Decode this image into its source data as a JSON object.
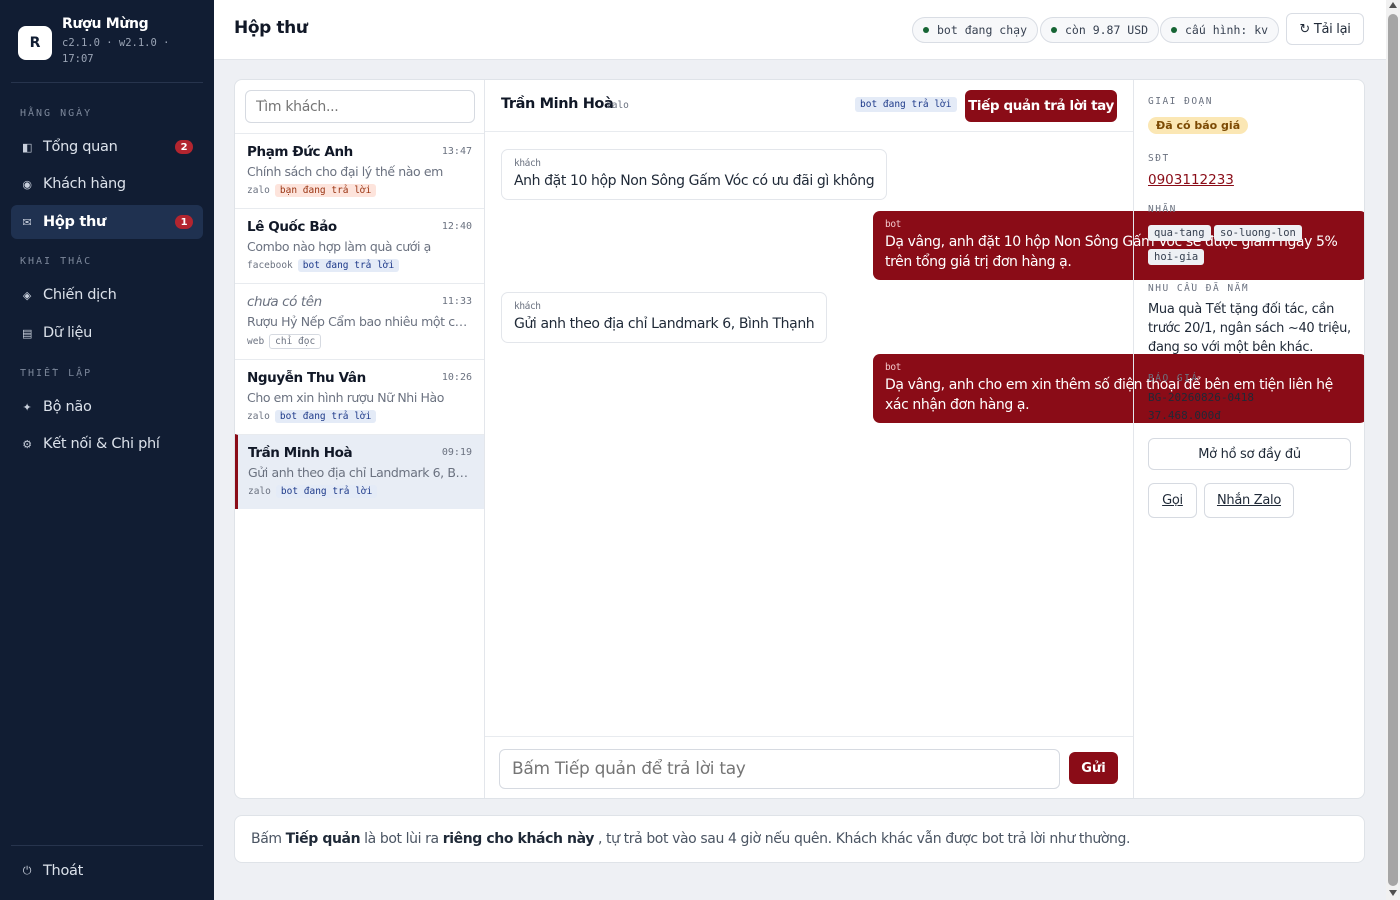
{
  "brand": {
    "initial": "R",
    "name": "Rượu Mừng",
    "version": "c2.1.0 · w2.1.0 · 17:07"
  },
  "sidebar": {
    "sections": [
      {
        "label": "HẰNG NGÀY"
      },
      {
        "label": "KHAI THÁC"
      },
      {
        "label": "THIẾT LẬP"
      }
    ],
    "items": [
      {
        "label": "Tổng quan",
        "icon": "grid-icon",
        "badge": "2"
      },
      {
        "label": "Khách hàng",
        "icon": "users-icon"
      },
      {
        "label": "Hộp thư",
        "icon": "mail-icon",
        "badge": "1",
        "active": true
      },
      {
        "label": "Chiến dịch",
        "icon": "megaphone-icon"
      },
      {
        "label": "Dữ liệu",
        "icon": "database-icon"
      },
      {
        "label": "Bộ não",
        "icon": "spark-icon"
      },
      {
        "label": "Kết nối & Chi phí",
        "icon": "gear-icon"
      }
    ],
    "logout": {
      "label": "Thoát",
      "icon": "power-icon"
    }
  },
  "header": {
    "title": "Hộp thư",
    "status_pills": [
      "bot đang chạy",
      "còn 9.87 USD",
      "cấu hình: kv"
    ],
    "status_color": "#166534",
    "reload_label": "↻ Tải lại"
  },
  "inbox": {
    "search_placeholder": "Tìm khách...",
    "conversations": [
      {
        "name": "Phạm Đức Anh",
        "time": "13:47",
        "preview": "Chính sách cho đại lý thế nào em",
        "channel": "zalo",
        "status": "bạn đang trả lời"
      },
      {
        "name": "Lê Quốc Bảo",
        "time": "12:40",
        "preview": "Combo nào hợp làm quà cưới ạ",
        "channel": "facebook",
        "status": "bot đang trả lời"
      },
      {
        "name": "chưa có tên",
        "time": "11:33",
        "preview": "Rượu Hỷ Nếp Cẩm bao nhiêu một chai?",
        "channel": "web",
        "status": "chỉ đọc"
      },
      {
        "name": "Nguyễn Thu Vân",
        "time": "10:26",
        "preview": "Cho em xin hình rượu Nữ Nhi Hào",
        "channel": "zalo",
        "status": "bot đang trả lời"
      },
      {
        "name": "Trần Minh Hoà",
        "time": "09:19",
        "preview": "Gửi anh theo địa chỉ Landmark 6, Bình Thạnh",
        "channel": "zalo",
        "status": "bot đang trả lời",
        "active": true
      }
    ]
  },
  "chat": {
    "name": "Trần Minh Hoà",
    "channel": "zalo",
    "status": "bot đang trả lời",
    "takeover_label": "Tiếp quản trả lời tay",
    "messages": [
      {
        "from": "khách",
        "text": "Anh đặt 10 hộp Non Sông Gấm Vóc có ưu đãi gì không"
      },
      {
        "from": "bot",
        "text": "Dạ vâng, anh đặt 10 hộp Non Sông Gấm Vóc sẽ được giảm ngay 5% trên tổng giá trị đơn hàng ạ."
      },
      {
        "from": "khách",
        "text": "Gửi anh theo địa chỉ Landmark 6, Bình Thạnh"
      },
      {
        "from": "bot",
        "text": "Dạ vâng, anh cho em xin thêm số điện thoại để bên em tiện liên hệ xác nhận đơn hàng ạ."
      }
    ],
    "reply_placeholder": "Bấm Tiếp quản để trả lời tay",
    "send_label": "Gửi"
  },
  "customer": {
    "stage_label": "GIAI ĐOẠN",
    "stage": "Đã có báo giá",
    "phone_label": "SĐT",
    "phone": "0903112233",
    "tags_label": "NHÃN",
    "tags": [
      "qua-tang",
      "so-luong-lon",
      "hoi-gia"
    ],
    "needs_label": "NHU CẦU ĐÃ NẮM",
    "needs": "Mua quà Tết tặng đối tác, cần trước 20/1, ngân sách ~40 triệu, đang so với một bên khác.",
    "quote_label": "BÁO GIÁ",
    "quote_id": "BG-20260826-0418",
    "quote_amount": "37.468.000đ",
    "profile_button": "Mở hồ sơ đầy đủ",
    "call_button": "Gọi",
    "zalo_button": "Nhắn Zalo"
  },
  "notice": {
    "part1": "Bấm",
    "bold1": "Tiếp quản",
    "part2": "là bot lùi ra",
    "bold2": "riêng cho khách này",
    "part3": ", tự trả bot vào sau 4 giờ nếu quên. Khách khác vẫn được bot trả lời như thường."
  },
  "colors": {
    "accent": "#8a0c17",
    "sidebar": "#111d33",
    "badge": "#b3252f"
  }
}
